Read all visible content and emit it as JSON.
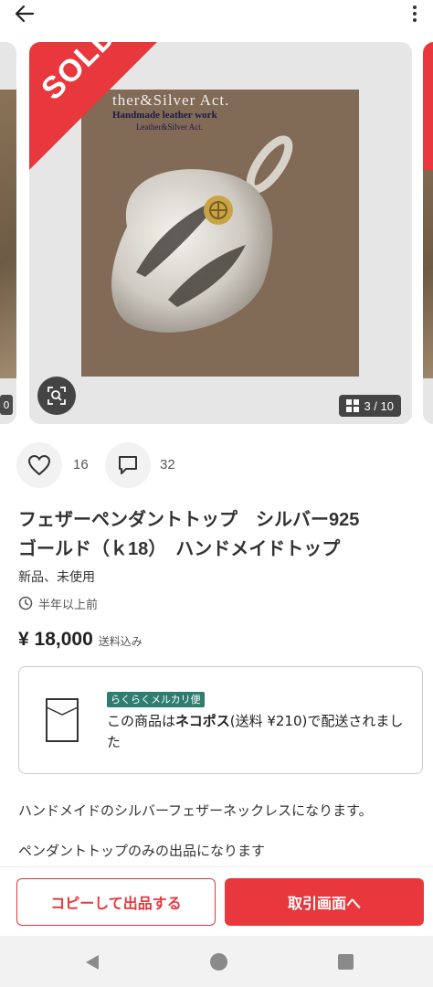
{
  "carousel": {
    "sold_label": "SOLD",
    "counter": "3 / 10",
    "photo_title": "ther&Silver Act.",
    "photo_subtitle": "Handmade leather work",
    "photo_subtitle2": "Leather&Silver Act."
  },
  "actions": {
    "likes": "16",
    "comments": "32"
  },
  "product": {
    "title_line1": "フェザーペンダントトップ　シルバー925",
    "title_line2": "ゴールド（ｋ18）　ハンドメイドトップ",
    "condition": "新品、未使用",
    "listed_time": "半年以上前",
    "price": "¥ 18,000",
    "shipping_included": "送料込み"
  },
  "shipping": {
    "method_tag": "らくらくメルカリ便",
    "text_prefix": "この商品は",
    "method_name": "ネコポス",
    "text_suffix": "(送料 ¥210)で配送されました"
  },
  "description": {
    "line1": "ハンドメイドのシルバーフェザーネックレスになります。",
    "line2": "ペンダントトップのみの出品になります"
  },
  "buttons": {
    "copy": "コピーして出品する",
    "trade": "取引画面へ"
  },
  "colors": {
    "accent": "#e8383d",
    "tag_green": "#2e7d6f"
  }
}
